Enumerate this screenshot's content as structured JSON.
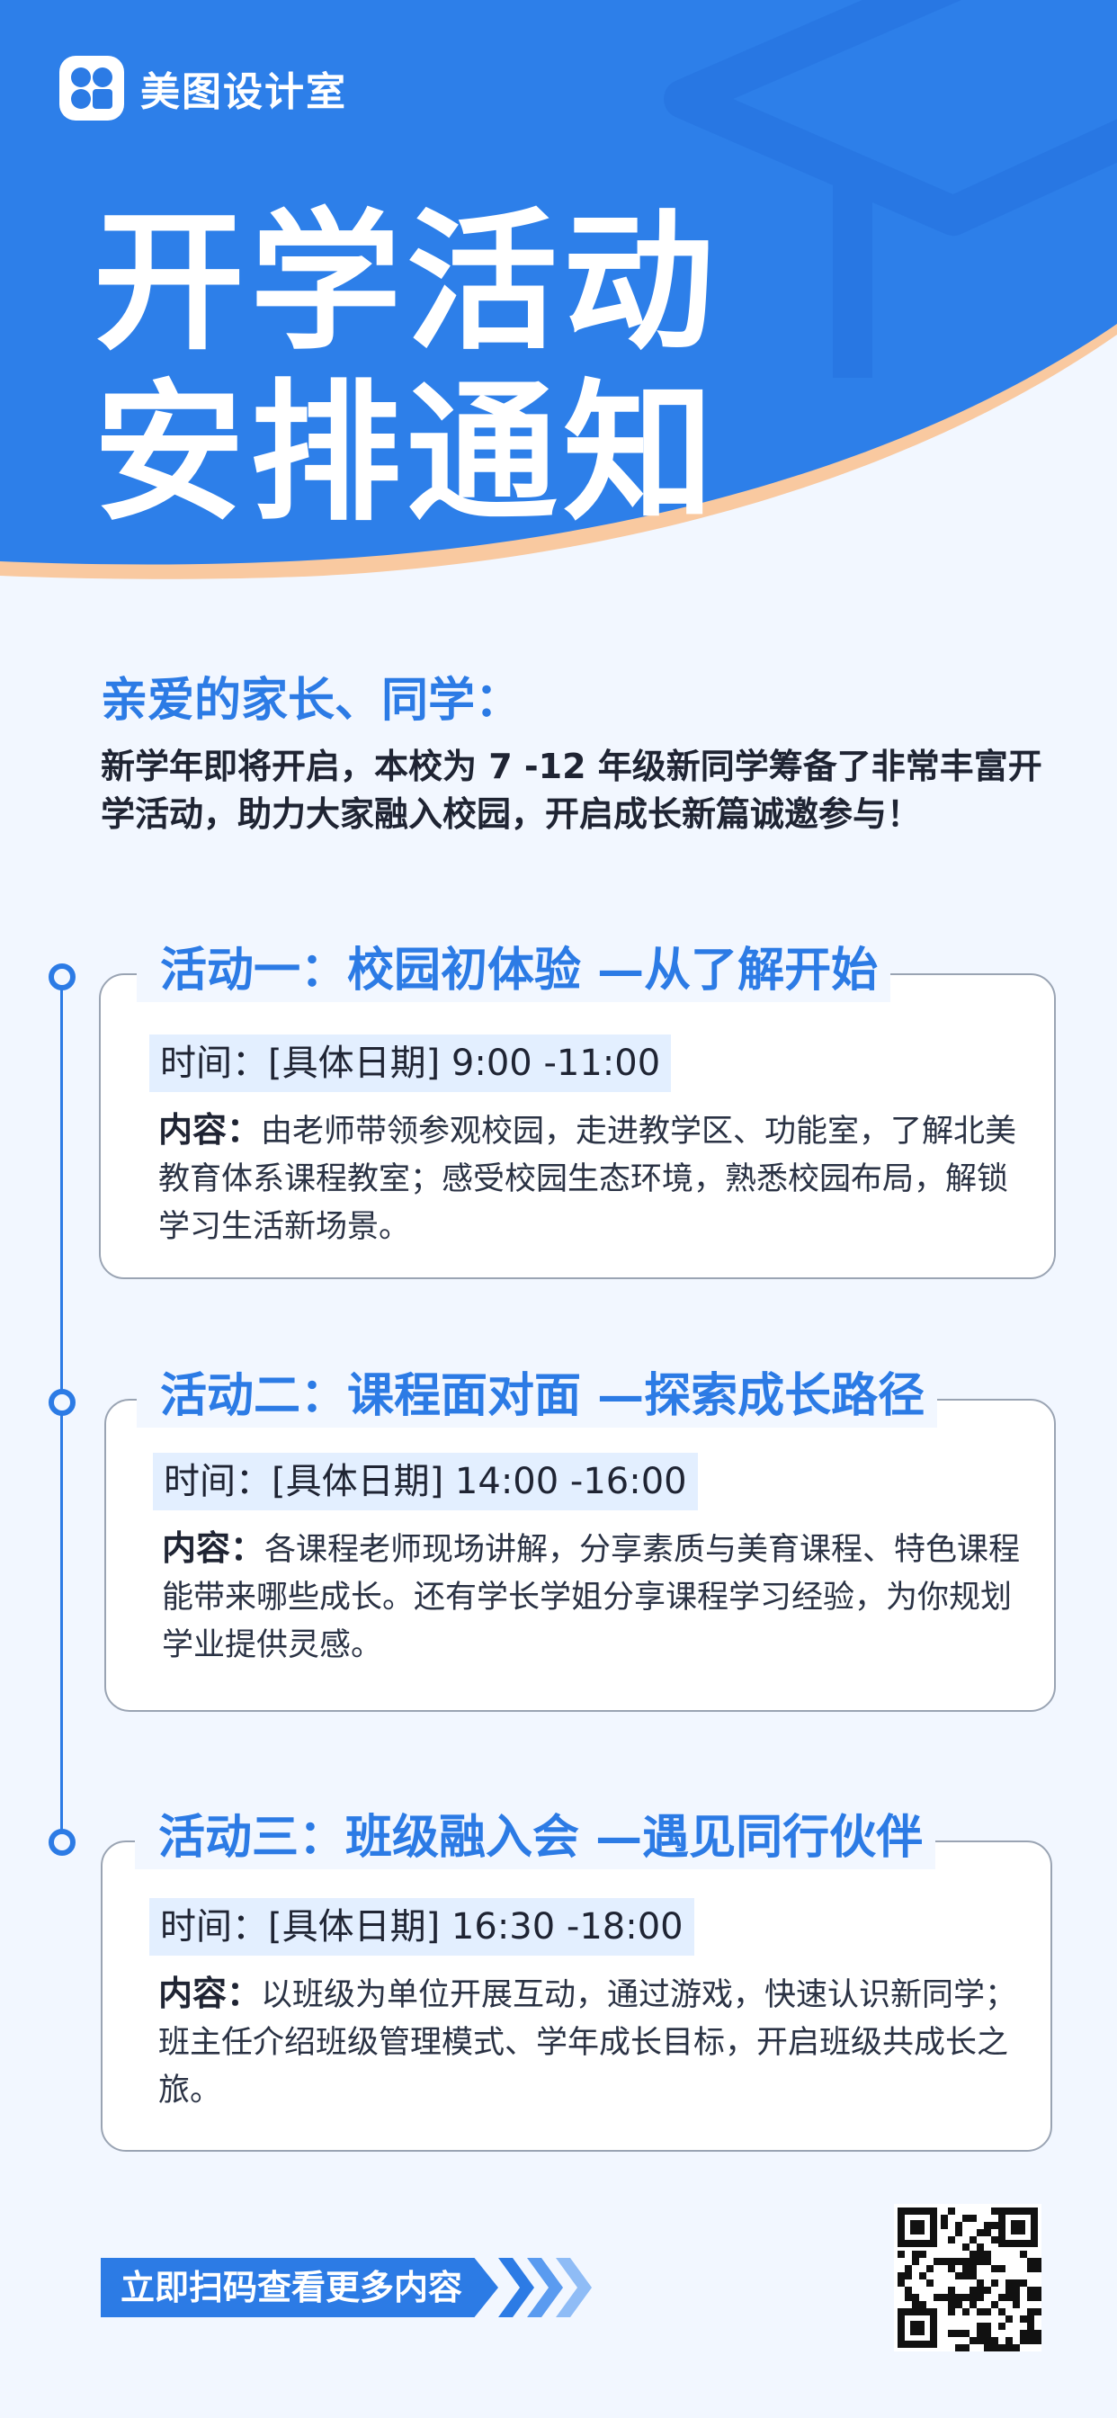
{
  "brand": {
    "name": "美图设计室",
    "logo_icon": "grid-logo-icon"
  },
  "title": {
    "line1": "开学活动",
    "line2": "安排通知"
  },
  "greeting": "亲爱的家长、同学：",
  "intro": "新学年即将开启，本校为 7 -12 年级新同学筹备了非常丰富开学活动，助力大家融入校园，开启成长新篇诚邀参与！",
  "activities": [
    {
      "title": "活动一：校园初体验 —从了解开始",
      "time": "时间：[具体日期] 9:00 -11:00",
      "content_label": "内容：",
      "content": "由老师带领参观校园，走进教学区、功能室，了解北美教育体系课程教室；感受校园生态环境，熟悉校园布局，解锁学习生活新场景。"
    },
    {
      "title": "活动二：课程面对面 —探索成长路径",
      "time": "时间：[具体日期] 14:00 -16:00",
      "content_label": "内容：",
      "content": "各课程老师现场讲解，分享素质与美育课程、特色课程能带来哪些成长。还有学长学姐分享课程学习经验，为你规划学业提供灵感。"
    },
    {
      "title": "活动三：班级融入会 —遇见同行伙伴",
      "time": "时间：[具体日期] 16:30 -18:00",
      "content_label": "内容：",
      "content": "以班级为单位开展互动，通过游戏，快速认识新同学；班主任介绍班级管理模式、学年成长目标，开启班级共成长之旅。"
    }
  ],
  "cta": {
    "label": "立即扫码查看更多内容",
    "arrow_icon": "chevron-right-icon"
  },
  "qr_icon": "qr-code-icon",
  "colors": {
    "primary": "#2c7be5",
    "accent_orange": "#f9c9a0",
    "background": "#f2f7ff",
    "time_highlight": "#e3efff"
  }
}
